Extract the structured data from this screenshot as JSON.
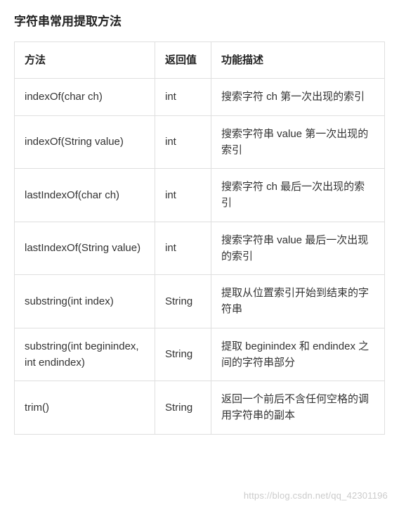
{
  "title": "字符串常用提取方法",
  "headers": {
    "method": "方法",
    "returnValue": "返回值",
    "description": "功能描述"
  },
  "rows": [
    {
      "method": "indexOf(char ch)",
      "returnValue": "int",
      "description": "搜索字符 ch 第一次出现的索引"
    },
    {
      "method": "indexOf(String value)",
      "returnValue": "int",
      "description": "搜索字符串 value 第一次出现的索引"
    },
    {
      "method": "lastIndexOf(char ch)",
      "returnValue": "int",
      "description": "搜索字符 ch 最后一次出现的索引"
    },
    {
      "method": "lastIndexOf(String value)",
      "returnValue": "int",
      "description": "搜索字符串 value 最后一次出现的索引"
    },
    {
      "method": "substring(int index)",
      "returnValue": "String",
      "description": "提取从位置索引开始到结束的字符串"
    },
    {
      "method": "substring(int beginindex, int endindex)",
      "returnValue": "String",
      "description": "提取 beginindex 和 endindex 之间的字符串部分"
    },
    {
      "method": "trim()",
      "returnValue": "String",
      "description": "返回一个前后不含任何空格的调用字符串的副本"
    }
  ],
  "watermark": "https://blog.csdn.net/qq_42301196"
}
